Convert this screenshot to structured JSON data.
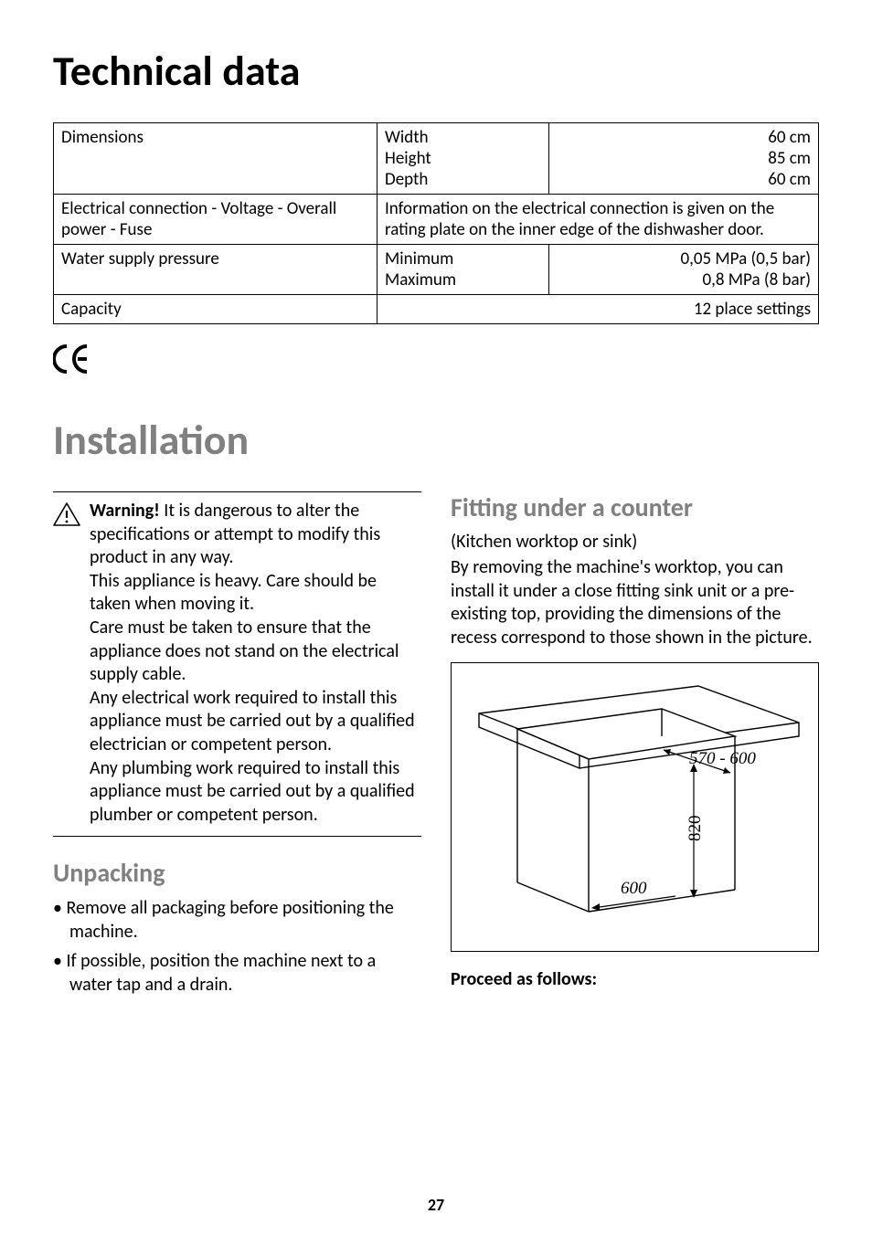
{
  "h1_tech": "Technical data",
  "table": {
    "r1c1": "Dimensions",
    "r1c2_a": "Width",
    "r1c2_b": "Height",
    "r1c2_c": "Depth",
    "r1c3_a": "60 cm",
    "r1c3_b": "85 cm",
    "r1c3_c": "60 cm",
    "r2c1": "Electrical connection - Voltage - Overall power - Fuse",
    "r2c23": "Information on the electrical connection is given on the rating plate on the inner edge of the dishwasher door.",
    "r3c1": "Water supply pressure",
    "r3c2_a": "Minimum",
    "r3c2_b": "Maximum",
    "r3c3_a": "0,05 MPa (0,5 bar)",
    "r3c3_b": "0,8 MPa (8 bar)",
    "r4c1": "Capacity",
    "r4c23": "12 place settings"
  },
  "ce_mark": "C‹",
  "h1_install": "Installation",
  "warning": {
    "lead": "Warning!",
    "p1": " It is dangerous to alter the specifications or attempt to modify this product in any way.",
    "p2": "This appliance is heavy. Care should be taken when moving it.",
    "p3": "Care must be taken to ensure that the appliance does not stand on the electrical supply cable.",
    "p4": "Any electrical work required to install this appliance must be carried out by a qualified electrician or competent person.",
    "p5": "Any plumbing work required to install this appliance must be carried out by a qualified plumber or competent person."
  },
  "unpacking": {
    "h": "Unpacking",
    "b1": "Remove all packaging before positioning the machine.",
    "b2": "If possible, position the machine next to a water tap and a drain."
  },
  "fitting": {
    "h": "Fitting under a counter",
    "sub": "(Kitchen worktop or sink)",
    "p": "By removing the machine's worktop, you can install it under a close fitting sink unit or a pre-existing top, providing the dimensions of the recess correspond to those shown in the picture.",
    "proceed": "Proceed as follows:"
  },
  "diagram": {
    "d1": "570 - 600",
    "d2": "820",
    "d3": "600"
  },
  "pagenum": "27"
}
